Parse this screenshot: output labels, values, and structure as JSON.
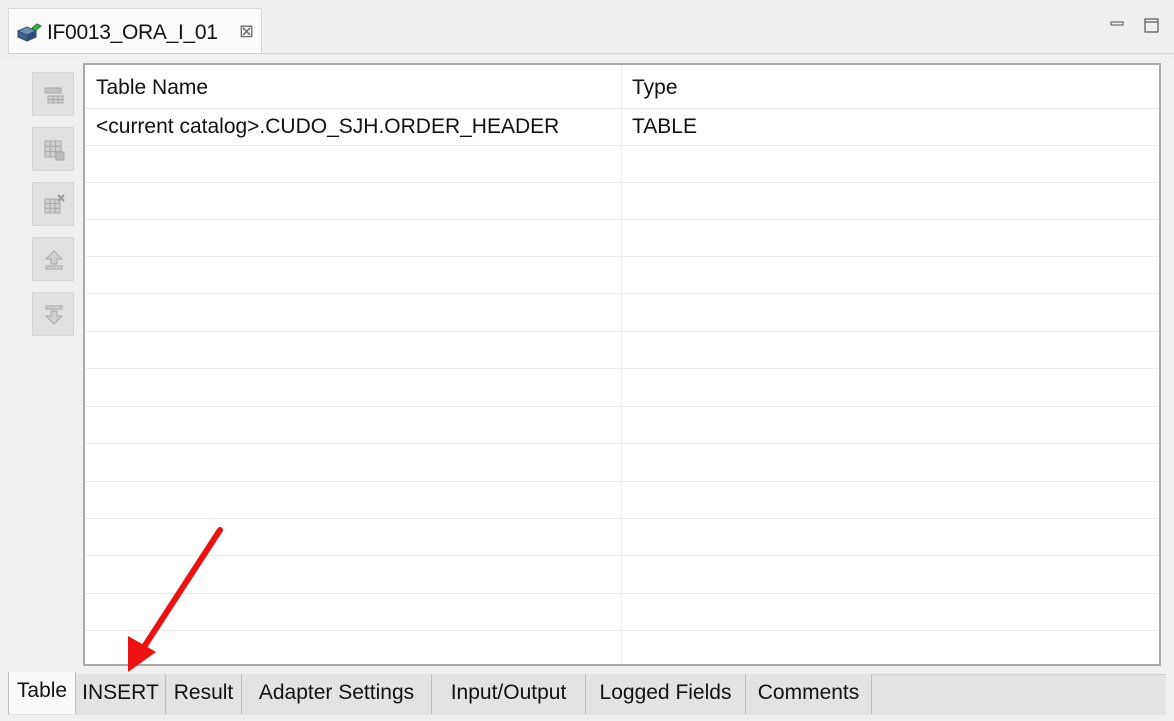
{
  "editor": {
    "tab_title": "IF0013_ORA_I_01",
    "close_glyph": "⊠"
  },
  "toolbar": {
    "icons": [
      "add-table-icon",
      "grid-icon",
      "remove-table-icon",
      "move-up-icon",
      "move-down-icon"
    ]
  },
  "table": {
    "headers": [
      "Table Name",
      "Type"
    ],
    "rows": [
      [
        "<current catalog>.CUDO_SJH.ORDER_HEADER",
        "TABLE"
      ]
    ]
  },
  "bottom_tabs": [
    "Table",
    "INSERT",
    "Result",
    "Adapter Settings",
    "Input/Output",
    "Logged Fields",
    "Comments"
  ],
  "colors": {
    "annotation_arrow": "#ee1111",
    "table_border": "#a9a9a9"
  }
}
